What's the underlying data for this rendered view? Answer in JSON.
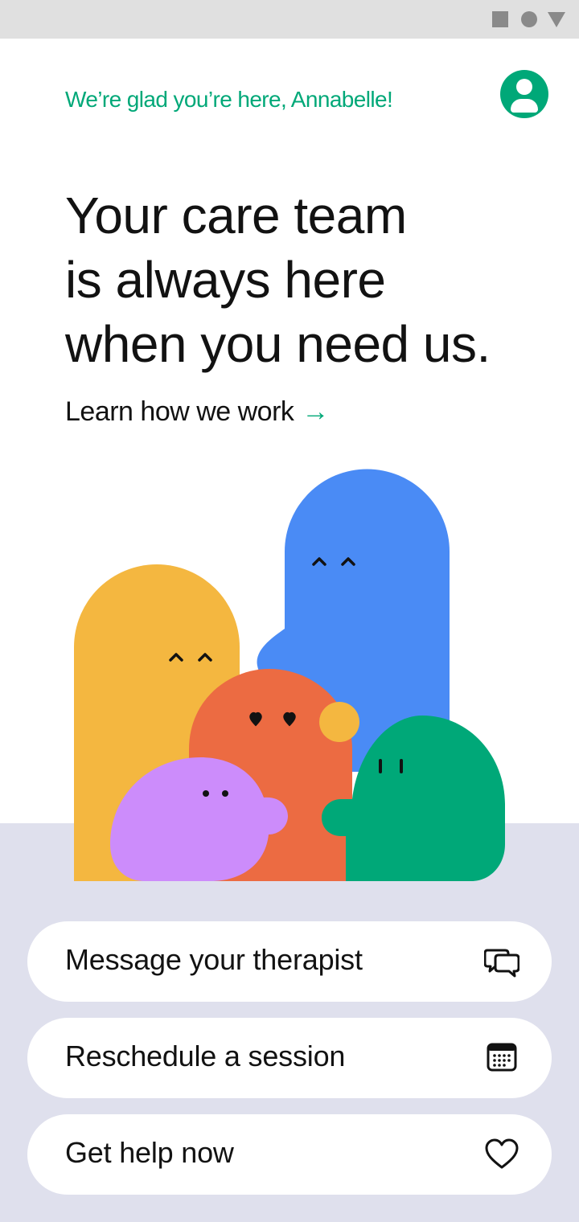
{
  "header": {
    "greeting": "We’re glad you’re here, Annabelle!",
    "avatar_icon": "user-avatar-icon"
  },
  "hero": {
    "headline_lines": [
      "Your care team",
      "is always here",
      "when you need us."
    ],
    "learn_link_label": "Learn how we work",
    "learn_link_arrow": "→"
  },
  "actions": [
    {
      "label": "Message your therapist",
      "icon": "chat-bubbles-icon"
    },
    {
      "label": "Reschedule a session",
      "icon": "calendar-icon"
    },
    {
      "label": "Get help now",
      "icon": "heart-icon"
    }
  ],
  "colors": {
    "accent": "#00a878",
    "bottom_background": "#dfe0ed",
    "character_yellow": "#f4b740",
    "character_blue": "#4a8bf5",
    "character_orange": "#ec6b42",
    "character_purple": "#cc8cfb",
    "character_green": "#00a878"
  }
}
